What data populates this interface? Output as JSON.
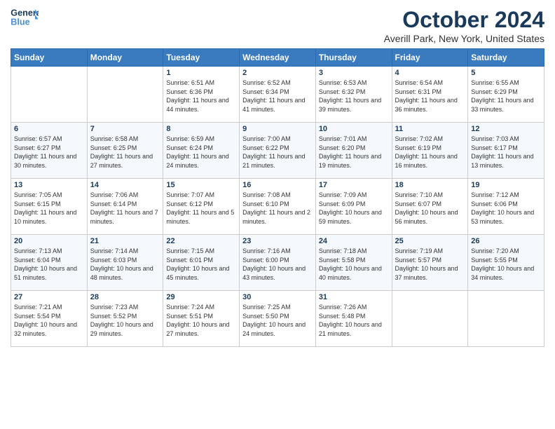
{
  "header": {
    "logo_general": "General",
    "logo_blue": "Blue",
    "month": "October 2024",
    "location": "Averill Park, New York, United States"
  },
  "days_of_week": [
    "Sunday",
    "Monday",
    "Tuesday",
    "Wednesday",
    "Thursday",
    "Friday",
    "Saturday"
  ],
  "weeks": [
    [
      {
        "day": "",
        "info": ""
      },
      {
        "day": "",
        "info": ""
      },
      {
        "day": "1",
        "info": "Sunrise: 6:51 AM\nSunset: 6:36 PM\nDaylight: 11 hours and 44 minutes."
      },
      {
        "day": "2",
        "info": "Sunrise: 6:52 AM\nSunset: 6:34 PM\nDaylight: 11 hours and 41 minutes."
      },
      {
        "day": "3",
        "info": "Sunrise: 6:53 AM\nSunset: 6:32 PM\nDaylight: 11 hours and 39 minutes."
      },
      {
        "day": "4",
        "info": "Sunrise: 6:54 AM\nSunset: 6:31 PM\nDaylight: 11 hours and 36 minutes."
      },
      {
        "day": "5",
        "info": "Sunrise: 6:55 AM\nSunset: 6:29 PM\nDaylight: 11 hours and 33 minutes."
      }
    ],
    [
      {
        "day": "6",
        "info": "Sunrise: 6:57 AM\nSunset: 6:27 PM\nDaylight: 11 hours and 30 minutes."
      },
      {
        "day": "7",
        "info": "Sunrise: 6:58 AM\nSunset: 6:25 PM\nDaylight: 11 hours and 27 minutes."
      },
      {
        "day": "8",
        "info": "Sunrise: 6:59 AM\nSunset: 6:24 PM\nDaylight: 11 hours and 24 minutes."
      },
      {
        "day": "9",
        "info": "Sunrise: 7:00 AM\nSunset: 6:22 PM\nDaylight: 11 hours and 21 minutes."
      },
      {
        "day": "10",
        "info": "Sunrise: 7:01 AM\nSunset: 6:20 PM\nDaylight: 11 hours and 19 minutes."
      },
      {
        "day": "11",
        "info": "Sunrise: 7:02 AM\nSunset: 6:19 PM\nDaylight: 11 hours and 16 minutes."
      },
      {
        "day": "12",
        "info": "Sunrise: 7:03 AM\nSunset: 6:17 PM\nDaylight: 11 hours and 13 minutes."
      }
    ],
    [
      {
        "day": "13",
        "info": "Sunrise: 7:05 AM\nSunset: 6:15 PM\nDaylight: 11 hours and 10 minutes."
      },
      {
        "day": "14",
        "info": "Sunrise: 7:06 AM\nSunset: 6:14 PM\nDaylight: 11 hours and 7 minutes."
      },
      {
        "day": "15",
        "info": "Sunrise: 7:07 AM\nSunset: 6:12 PM\nDaylight: 11 hours and 5 minutes."
      },
      {
        "day": "16",
        "info": "Sunrise: 7:08 AM\nSunset: 6:10 PM\nDaylight: 11 hours and 2 minutes."
      },
      {
        "day": "17",
        "info": "Sunrise: 7:09 AM\nSunset: 6:09 PM\nDaylight: 10 hours and 59 minutes."
      },
      {
        "day": "18",
        "info": "Sunrise: 7:10 AM\nSunset: 6:07 PM\nDaylight: 10 hours and 56 minutes."
      },
      {
        "day": "19",
        "info": "Sunrise: 7:12 AM\nSunset: 6:06 PM\nDaylight: 10 hours and 53 minutes."
      }
    ],
    [
      {
        "day": "20",
        "info": "Sunrise: 7:13 AM\nSunset: 6:04 PM\nDaylight: 10 hours and 51 minutes."
      },
      {
        "day": "21",
        "info": "Sunrise: 7:14 AM\nSunset: 6:03 PM\nDaylight: 10 hours and 48 minutes."
      },
      {
        "day": "22",
        "info": "Sunrise: 7:15 AM\nSunset: 6:01 PM\nDaylight: 10 hours and 45 minutes."
      },
      {
        "day": "23",
        "info": "Sunrise: 7:16 AM\nSunset: 6:00 PM\nDaylight: 10 hours and 43 minutes."
      },
      {
        "day": "24",
        "info": "Sunrise: 7:18 AM\nSunset: 5:58 PM\nDaylight: 10 hours and 40 minutes."
      },
      {
        "day": "25",
        "info": "Sunrise: 7:19 AM\nSunset: 5:57 PM\nDaylight: 10 hours and 37 minutes."
      },
      {
        "day": "26",
        "info": "Sunrise: 7:20 AM\nSunset: 5:55 PM\nDaylight: 10 hours and 34 minutes."
      }
    ],
    [
      {
        "day": "27",
        "info": "Sunrise: 7:21 AM\nSunset: 5:54 PM\nDaylight: 10 hours and 32 minutes."
      },
      {
        "day": "28",
        "info": "Sunrise: 7:23 AM\nSunset: 5:52 PM\nDaylight: 10 hours and 29 minutes."
      },
      {
        "day": "29",
        "info": "Sunrise: 7:24 AM\nSunset: 5:51 PM\nDaylight: 10 hours and 27 minutes."
      },
      {
        "day": "30",
        "info": "Sunrise: 7:25 AM\nSunset: 5:50 PM\nDaylight: 10 hours and 24 minutes."
      },
      {
        "day": "31",
        "info": "Sunrise: 7:26 AM\nSunset: 5:48 PM\nDaylight: 10 hours and 21 minutes."
      },
      {
        "day": "",
        "info": ""
      },
      {
        "day": "",
        "info": ""
      }
    ]
  ]
}
